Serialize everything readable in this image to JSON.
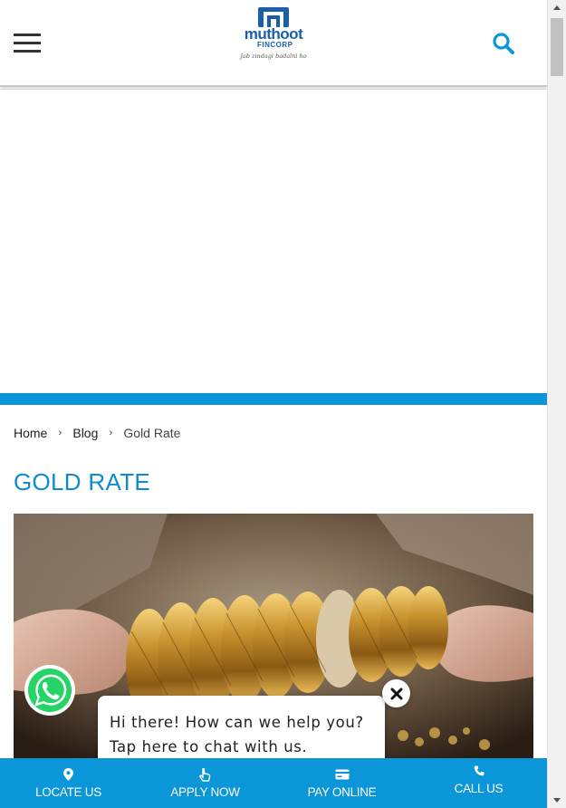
{
  "header": {
    "menu_icon": "hamburger-icon",
    "logo": {
      "brand": "muthoot",
      "sub": "FINCORP",
      "tagline": "Jab zindagi badalni ho",
      "brand_color": "#1a5fa8"
    },
    "search_icon": "search-icon"
  },
  "breadcrumb": {
    "items": [
      "Home",
      "Blog"
    ],
    "current": "Gold Rate"
  },
  "page": {
    "title": "GOLD RATE",
    "title_color": "#0d8bd0",
    "accent_bar_color": "#0a96d8"
  },
  "hero": {
    "image_icon": "gold-bangles-photo"
  },
  "chat_widget": {
    "whatsapp_icon": "whatsapp-icon",
    "message": "Hi there! How can we help you? Tap here to chat with us.",
    "close_icon": "close-icon"
  },
  "bottom_nav": {
    "bg_color": "#0a96d8",
    "items": [
      {
        "label": "LOCATE US",
        "icon": "location-pin-icon"
      },
      {
        "label": "APPLY NOW",
        "icon": "hand-pointer-icon"
      },
      {
        "label": "PAY ONLINE",
        "icon": "credit-card-icon"
      },
      {
        "label": "CALL US",
        "icon": "phone-icon"
      }
    ]
  }
}
